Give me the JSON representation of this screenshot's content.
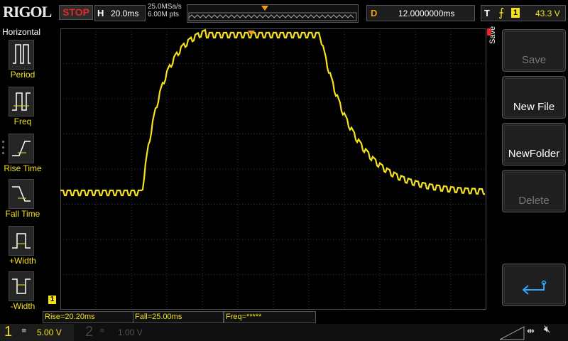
{
  "brand": "RIGOL",
  "status": "STOP",
  "horizontal": {
    "tag": "H",
    "timebase": "20.0ms",
    "sample_rate": "25.0MSa/s",
    "points": "6.00M pts"
  },
  "delay": {
    "tag": "D",
    "value": "12.0000000ms"
  },
  "trigger": {
    "tag": "T",
    "edge": "⨍",
    "source": "1",
    "level": "43.3 V"
  },
  "left_menu": {
    "title": "Horizontal",
    "items": [
      {
        "label": "Period",
        "icon": "period-icon"
      },
      {
        "label": "Freq",
        "icon": "freq-icon"
      },
      {
        "label": "Rise Time",
        "icon": "rise-time-icon"
      },
      {
        "label": "Fall Time",
        "icon": "fall-time-icon"
      },
      {
        "label": "+Width",
        "icon": "positive-width-icon"
      },
      {
        "label": "-Width",
        "icon": "negative-width-icon"
      }
    ]
  },
  "right_menu": {
    "title": "Save",
    "buttons": [
      {
        "label": "Save",
        "enabled": false
      },
      {
        "label": "New File",
        "enabled": true
      },
      {
        "label": "NewFolder",
        "enabled": true
      },
      {
        "label": "Delete",
        "enabled": false
      },
      {
        "label": "",
        "icon": "enter-icon",
        "enabled": true
      }
    ]
  },
  "measurements": {
    "rise": "Rise=20.20ms",
    "fall": "Fall=25.00ms",
    "freq": "Freq=*****"
  },
  "ground_marker": "1",
  "channels": [
    {
      "number": "1",
      "coupling": "≅",
      "scale": "5.00 V",
      "active": true,
      "color": "#f5e21b"
    },
    {
      "number": "2",
      "coupling": "≅",
      "scale": "1.00 V",
      "active": false,
      "color": "#3a3a3a"
    }
  ],
  "colors": {
    "ch1": "#f5e21b",
    "stop": "#e52828",
    "delay": "#f39c12",
    "grid": "#3c3c3c"
  },
  "icons": {
    "usb": "usb-icon",
    "mute": "speaker-mute-icon"
  }
}
